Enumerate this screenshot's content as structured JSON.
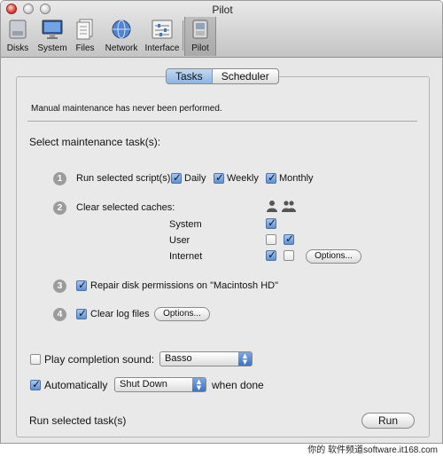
{
  "window": {
    "title": "Pilot"
  },
  "toolbar": {
    "items": [
      {
        "label": "Disks",
        "icon": "disks-icon"
      },
      {
        "label": "System",
        "icon": "system-icon"
      },
      {
        "label": "Files",
        "icon": "files-icon"
      },
      {
        "label": "Network",
        "icon": "network-icon"
      },
      {
        "label": "Interface",
        "icon": "interface-icon"
      },
      {
        "label": "Pilot",
        "icon": "pilot-icon",
        "selected": true
      }
    ]
  },
  "tabs": [
    {
      "label": "Tasks",
      "selected": true
    },
    {
      "label": "Scheduler",
      "selected": false
    }
  ],
  "status_message": "Manual maintenance has never been performed.",
  "section_title": "Select maintenance task(s):",
  "tasks": {
    "t1": {
      "number": "1",
      "label": "Run selected script(s):",
      "scripts": [
        {
          "label": "Daily",
          "checked": true
        },
        {
          "label": "Weekly",
          "checked": true
        },
        {
          "label": "Monthly",
          "checked": true
        }
      ]
    },
    "t2": {
      "number": "2",
      "label": "Clear selected caches:",
      "user_icon": "single-user-icon",
      "users_icon": "multiple-users-icon",
      "rows": [
        {
          "label": "System",
          "single": true,
          "multi": null
        },
        {
          "label": "User",
          "single": false,
          "multi": true
        },
        {
          "label": "Internet",
          "single": true,
          "multi": false,
          "button": "Options..."
        }
      ]
    },
    "t3": {
      "number": "3",
      "label": "Repair disk permissions on \"Macintosh HD\"",
      "checked": true
    },
    "t4": {
      "number": "4",
      "label": "Clear log files",
      "checked": true,
      "button": "Options..."
    }
  },
  "sound": {
    "label": "Play completion sound:",
    "checked": false,
    "value": "Basso"
  },
  "auto": {
    "label": "Automatically",
    "checked": true,
    "value": "Shut Down",
    "suffix": "when done"
  },
  "footer": {
    "label": "Run selected task(s)",
    "button": "Run"
  },
  "watermark": "你的 软件频道software.it168.com"
}
